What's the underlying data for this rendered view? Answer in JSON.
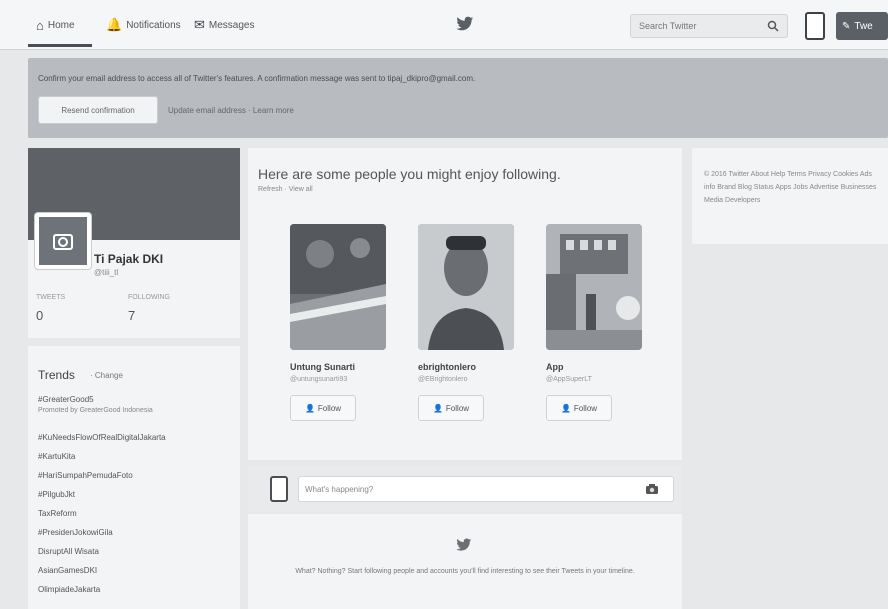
{
  "topnav": {
    "home_label": "Home",
    "notifications_label": "Notifications",
    "messages_label": "Messages",
    "search_placeholder": "Search Twitter",
    "tweet_label": "Twe"
  },
  "banner": {
    "text": "Confirm your email address to access all of Twitter's features. A confirmation message was sent to tipaj_dkipro@gmail.com.",
    "resend_label": "Resend confirmation",
    "update_label": "Update email address · Learn more"
  },
  "profile": {
    "name": "Ti Pajak DKI",
    "handle": "@tiii_tl",
    "tweets_label": "TWEETS",
    "tweets_value": "0",
    "following_label": "FOLLOWING",
    "following_value": "7"
  },
  "trends": {
    "title": "Trends",
    "change_label": "· Change",
    "items": [
      {
        "text": "#GreaterGood5",
        "promoted": "Promoted by GreaterGood Indonesia"
      },
      {
        "text": ""
      },
      {
        "text": "#KuNeedsFlowOfRealDigitalJakarta"
      },
      {
        "text": "#KartuKita"
      },
      {
        "text": "#HariSumpahPemudaFoto"
      },
      {
        "text": "#PilgubJkt"
      },
      {
        "text": "TaxReform"
      },
      {
        "text": "#PresidenJokowiGila"
      },
      {
        "text": "DisruptAll Wisata"
      },
      {
        "text": "AsianGamesDKI"
      },
      {
        "text": "OlimpiadeJakarta"
      }
    ]
  },
  "main": {
    "heading": "Here are some people you might enjoy following.",
    "sub": "Refresh · View all",
    "people": [
      {
        "name": "Untung Sunarti",
        "handle": "@untungsunarti93",
        "follow": "Follow"
      },
      {
        "name": "ebrightonlero",
        "handle": "@EBrightonlero",
        "follow": "Follow"
      },
      {
        "name": "App",
        "handle": "@AppSuperLT",
        "follow": "Follow"
      }
    ]
  },
  "composer": {
    "placeholder": "What's happening?"
  },
  "feed": {
    "empty_text": "What? Nothing? Start following people and accounts you'll find interesting to see their Tweets in your timeline."
  },
  "right": {
    "text": "© 2016 Twitter About Help Terms Privacy Cookies Ads info Brand Blog Status Apps Jobs Advertise Businesses Media Developers"
  },
  "colors": {
    "page_bg": "#e6e8ea",
    "banner_bg": "#b8bbbf",
    "profile_header": "#5e6267",
    "tweet_button": "#5b6067"
  }
}
